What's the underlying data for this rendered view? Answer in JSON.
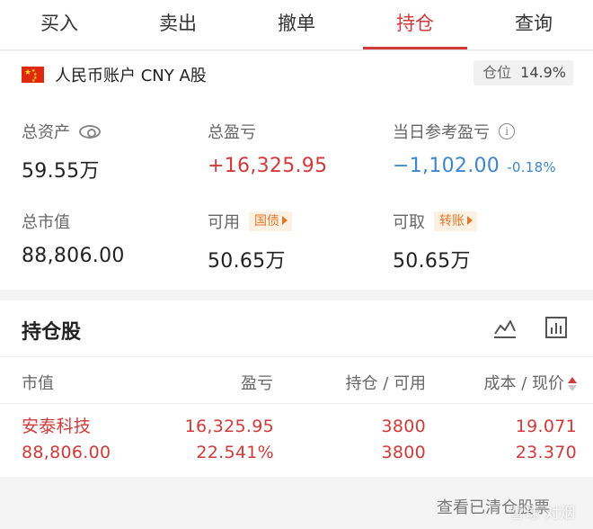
{
  "tabs": [
    {
      "label": "买入"
    },
    {
      "label": "卖出"
    },
    {
      "label": "撤单"
    },
    {
      "label": "持仓"
    },
    {
      "label": "查询"
    }
  ],
  "account": {
    "name": "人民币账户 CNY A股",
    "position_label": "仓位",
    "position_value": "14.9%"
  },
  "summary": {
    "total_assets_label": "总资产",
    "total_assets_value": "59.55万",
    "total_pl_label": "总盈亏",
    "total_pl_value": "+16,325.95",
    "day_pl_label": "当日参考盈亏",
    "day_pl_value": "−1,102.00",
    "day_pl_pct": "-0.18%",
    "market_value_label": "总市值",
    "market_value_value": "88,806.00",
    "available_label": "可用",
    "available_tag": "国债",
    "available_value": "50.65万",
    "withdrawable_label": "可取",
    "withdrawable_tag": "转账",
    "withdrawable_value": "50.65万"
  },
  "positions": {
    "title": "持仓股",
    "headers": {
      "market_value": "市值",
      "pl": "盈亏",
      "holding": "持仓 / 可用",
      "cost": "成本 / 现价"
    },
    "rows": [
      {
        "name": "安泰科技",
        "market_value": "88,806.00",
        "pl": "16,325.95",
        "pl_pct": "22.541%",
        "holding": "3800",
        "available": "3800",
        "cost": "19.071",
        "price": "23.370"
      }
    ]
  },
  "footer": {
    "view_cleared": "查看已清仓股票",
    "watermark": "雪球 对烟"
  },
  "colors": {
    "accent_red": "#d03a3a",
    "loss_blue": "#3e86c9",
    "tag_orange": "#e0782b"
  }
}
